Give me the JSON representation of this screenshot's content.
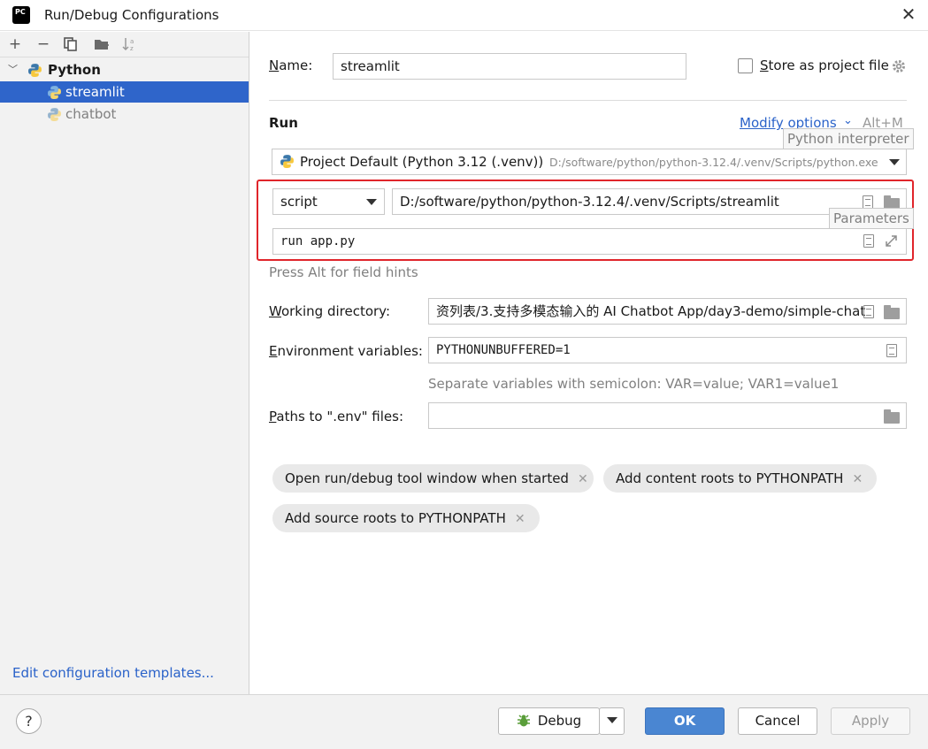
{
  "window": {
    "title": "Run/Debug Configurations",
    "app_icon_text": "PC"
  },
  "left_pane": {
    "toolbar": [
      "+",
      "−",
      "⧉",
      "📁",
      "↓"
    ],
    "tree": {
      "group_label": "Python",
      "items": [
        {
          "label": "streamlit",
          "selected": true
        },
        {
          "label": "chatbot",
          "selected": false
        }
      ]
    },
    "edit_templates_link": "Edit configuration templates..."
  },
  "form": {
    "name_label": "Name:",
    "name_value": "streamlit",
    "store_as_project_file_label": "Store as project file",
    "store_as_project_file_checked": false,
    "run_section_title": "Run",
    "modify_options_label": "Modify options",
    "modify_options_shortcut": "Alt+M",
    "python_interpreter_tooltip": "Python interpreter",
    "interpreter_name": "Project Default (Python 3.12 (.venv))",
    "interpreter_path": "D:/software/python/python-3.12.4/.venv/Scripts/python.exe",
    "run_type_value": "script",
    "script_path_value": "D:/software/python/python-3.12.4/.venv/Scripts/streamlit",
    "parameters_tooltip": "Parameters",
    "parameters_value": "run app.py",
    "field_hints_text": "Press Alt for field hints",
    "working_directory_label": "Working directory:",
    "working_directory_value": "资列表/3.支持多模态输入的 AI Chatbot App/day3-demo/simple-chat",
    "environment_variables_label": "Environment variables:",
    "environment_variables_value": "PYTHONUNBUFFERED=1",
    "env_hint": "Separate variables with semicolon: VAR=value; VAR1=value1",
    "paths_env_label": "Paths to \".env\" files:",
    "paths_env_value": ""
  },
  "chips": [
    {
      "label": "Open run/debug tool window when started"
    },
    {
      "label": "Add content roots to PYTHONPATH"
    },
    {
      "label": "Add source roots to PYTHONPATH"
    }
  ],
  "buttons": {
    "help": "?",
    "debug": "Debug",
    "ok": "OK",
    "cancel": "Cancel",
    "apply": "Apply"
  },
  "colors": {
    "selection": "#2f65ca",
    "link": "#2a62c9",
    "highlight_box": "#e0252b",
    "primary_button": "#4a86d2"
  }
}
